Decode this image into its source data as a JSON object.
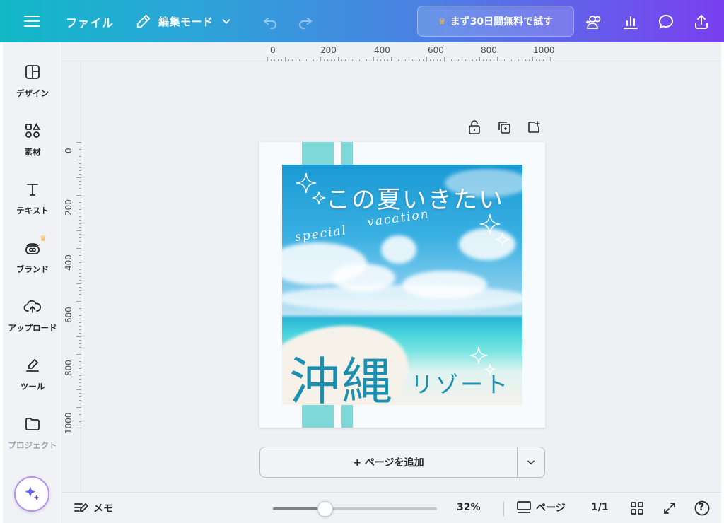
{
  "topbar": {
    "file_label": "ファイル",
    "edit_mode_label": "編集モード",
    "trial_label": "まず30日間無料で試す",
    "trial_icon": "crown-icon",
    "icons": [
      "menu-icon",
      "pencil-icon",
      "chevron-down-icon",
      "undo-icon",
      "redo-icon",
      "share-people-icon",
      "insights-icon",
      "comment-icon",
      "upload-icon"
    ]
  },
  "sidebar": {
    "items": [
      {
        "label": "デザイン",
        "icon": "design-icon"
      },
      {
        "label": "素材",
        "icon": "elements-icon"
      },
      {
        "label": "テキスト",
        "icon": "text-icon"
      },
      {
        "label": "ブランド",
        "icon": "brand-icon"
      },
      {
        "label": "アップロード",
        "icon": "upload-cloud-icon"
      },
      {
        "label": "ツール",
        "icon": "draw-icon"
      },
      {
        "label": "プロジェクト",
        "icon": "folder-icon"
      }
    ],
    "magic_icon": "sparkle-icon"
  },
  "rulers": {
    "top": [
      "0",
      "200",
      "400",
      "600",
      "800",
      "1000"
    ],
    "left": [
      "0",
      "200",
      "400",
      "600",
      "800",
      "1000"
    ]
  },
  "page_tools": [
    "lock-icon",
    "duplicate-icon",
    "add-page-icon"
  ],
  "design": {
    "headline": "この夏いきたい",
    "script_1": "special",
    "script_2": "vacation",
    "big_title": "沖縄",
    "sub_title": "リゾート",
    "colors": {
      "stripe": "#7fd8d8",
      "title": "#1b8fb0"
    }
  },
  "add_page": {
    "label": "+ ページを追加"
  },
  "bottombar": {
    "memo_label": "メモ",
    "zoom_label": "32%",
    "zoom_level": 0.32,
    "pages_label": "ページ",
    "page_count": "1/1",
    "help": "?"
  }
}
